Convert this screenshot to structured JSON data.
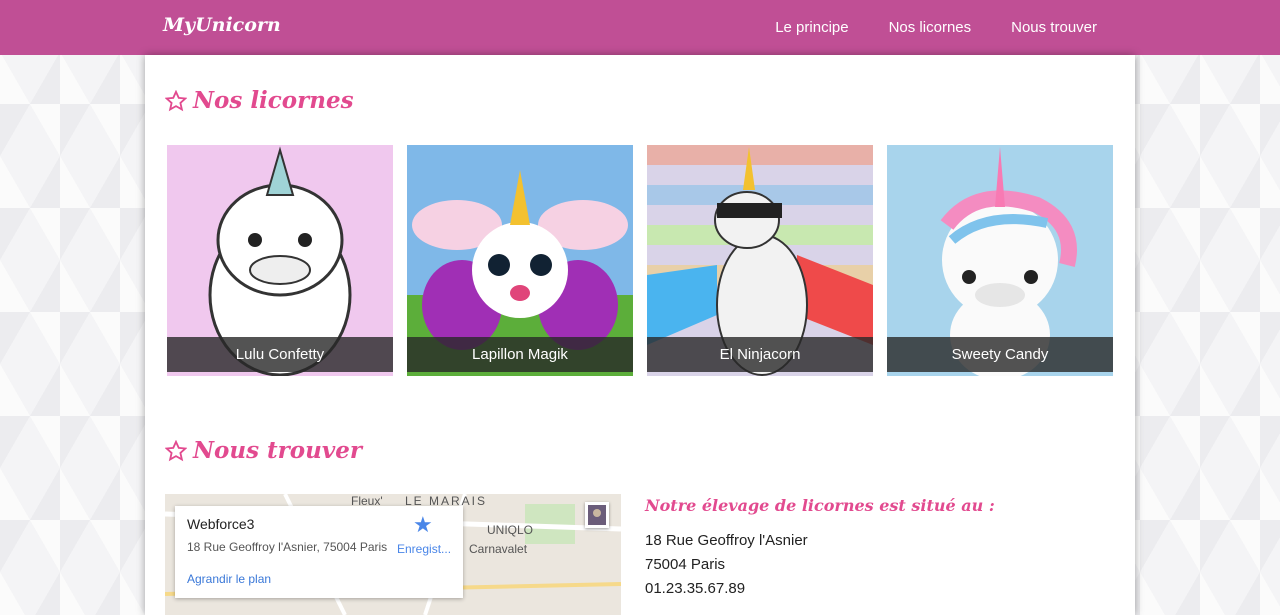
{
  "navbar": {
    "brand": "MyUnicorn",
    "links": [
      "Le principe",
      "Nos licornes",
      "Nous trouver"
    ],
    "color": "#c04f95"
  },
  "sections": {
    "unicorns_title": "Nos licornes",
    "find_title": "Nous trouver"
  },
  "unicorns": [
    {
      "name": "Lulu Confetty"
    },
    {
      "name": "Lapillon Magik"
    },
    {
      "name": "El Ninjacorn"
    },
    {
      "name": "Sweety Candy"
    }
  ],
  "map": {
    "labels": [
      "LE MARAIS",
      "Fleux'",
      "UNIQLO",
      "Carnavalet"
    ],
    "infobox": {
      "title": "Webforce3",
      "address": "18 Rue Geoffroy l'Asnier, 75004 Paris",
      "save_label": "Enregist...",
      "link_label": "Agrandir le plan"
    }
  },
  "address": {
    "heading": "Notre élevage de licornes est situé au :",
    "street": "18 Rue Geoffroy l'Asnier",
    "city": "75004 Paris",
    "phone": "01.23.35.67.89"
  },
  "accent_color": "#e24a8f"
}
